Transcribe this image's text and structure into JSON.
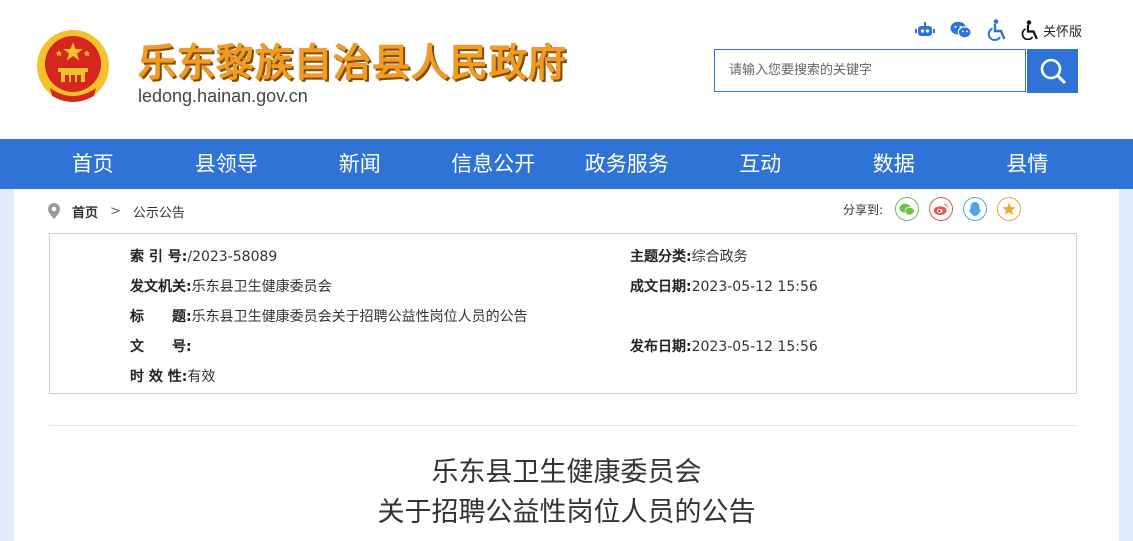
{
  "header": {
    "site_title": "乐东黎族自治县人民政府",
    "site_domain": "ledong.hainan.gov.cn",
    "tools": {
      "care_label": "关怀版"
    },
    "search": {
      "placeholder": "请输入您要搜索的关键字"
    }
  },
  "nav": [
    "首页",
    "县领导",
    "新闻",
    "信息公开",
    "政务服务",
    "互动",
    "数据",
    "县情"
  ],
  "breadcrumb": {
    "home": "首页",
    "separator": ">",
    "current": "公示公告"
  },
  "share": {
    "label": "分享到:"
  },
  "info": {
    "index_label": "索 引 号:",
    "index_value": "/2023-58089",
    "topic_label": "主题分类:",
    "topic_value": "综合政务",
    "issuer_label": "发文机关:",
    "issuer_value": "乐东县卫生健康委员会",
    "created_label": "成文日期:",
    "created_value": "2023-05-12 15:56",
    "title_label": "标　　题:",
    "title_value": "乐东县卫生健康委员会关于招聘公益性岗位人员的公告",
    "docno_label": "文　　号:",
    "docno_value": "",
    "published_label": "发布日期:",
    "published_value": "2023-05-12 15:56",
    "validity_label": "时 效 性:",
    "validity_value": "有效"
  },
  "article": {
    "title_line1": "乐东县卫生健康委员会",
    "title_line2": "关于招聘公益性岗位人员的公告"
  },
  "colors": {
    "accent": "#2f73d6",
    "title_orange": "#f29b21",
    "emblem_red": "#d7261e",
    "emblem_gold": "#f6c22c"
  }
}
